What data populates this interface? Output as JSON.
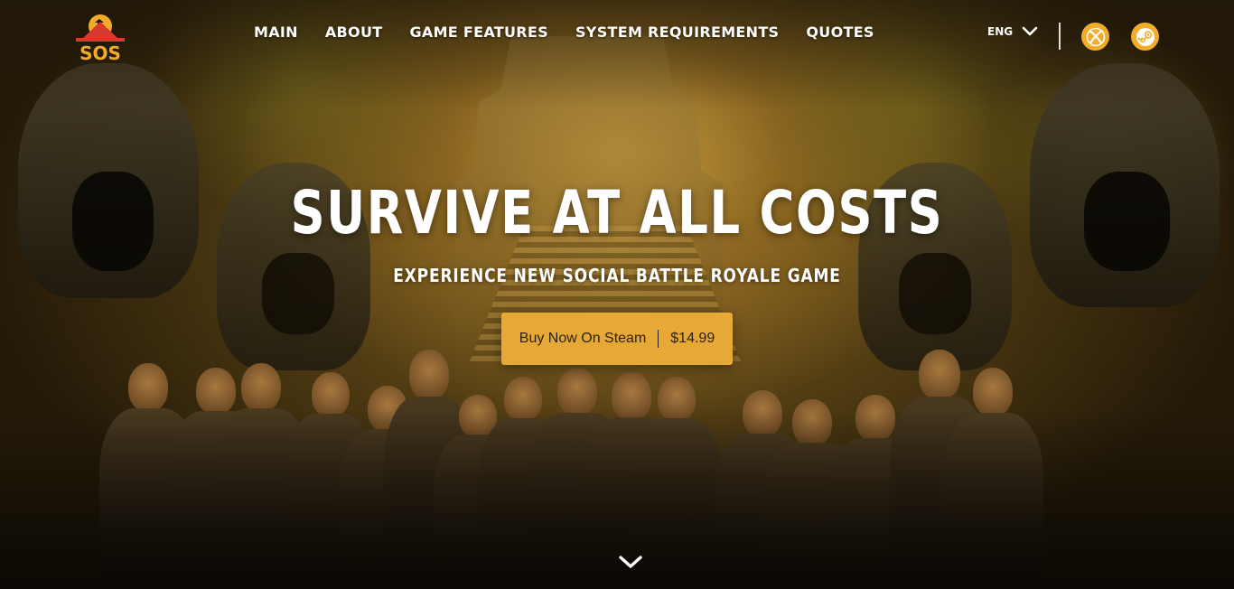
{
  "header": {
    "logo_text": "SOS",
    "nav": [
      {
        "label": "MAIN"
      },
      {
        "label": "ABOUT"
      },
      {
        "label": "GAME FEATURES"
      },
      {
        "label": "SYSTEM REQUIREMENTS"
      },
      {
        "label": "QUOTES"
      }
    ],
    "language": "ENG",
    "platforms": [
      {
        "icon": "xbox-icon"
      },
      {
        "icon": "steam-icon"
      }
    ]
  },
  "hero": {
    "title": "SURVIVE AT ALL COSTS",
    "subtitle": "EXPERIENCE NEW SOCIAL BATTLE ROYALE GAME",
    "buy_button": {
      "label": "Buy Now On Steam",
      "price": "$14.99"
    }
  },
  "colors": {
    "accent": "#e7a935",
    "platform_icon_bg": "#f3ac2a",
    "logo_red": "#d8392b",
    "text": "#ffffff"
  }
}
